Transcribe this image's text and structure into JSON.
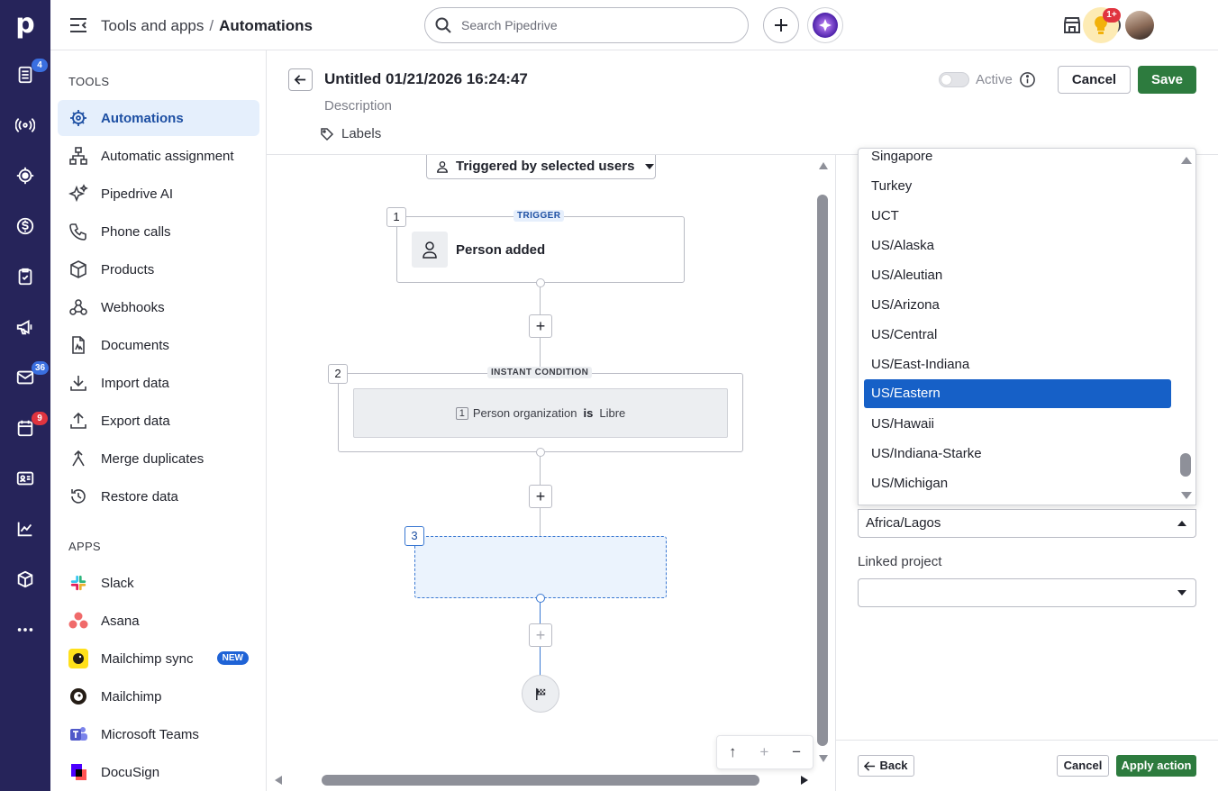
{
  "rail": {
    "logo": "p",
    "items": [
      {
        "icon": "deals-icon",
        "badge": "4"
      },
      {
        "icon": "broadcast-icon",
        "badge": ""
      },
      {
        "icon": "target-icon",
        "badge": ""
      },
      {
        "icon": "dollar-icon",
        "badge": ""
      },
      {
        "icon": "tasks-icon",
        "badge": ""
      },
      {
        "icon": "megaphone-icon",
        "badge": ""
      },
      {
        "icon": "mail-icon",
        "badge": "36"
      },
      {
        "icon": "calendar-icon",
        "badge": "9"
      },
      {
        "icon": "contacts-icon",
        "badge": ""
      },
      {
        "icon": "insights-icon",
        "badge": ""
      },
      {
        "icon": "products-icon",
        "badge": ""
      },
      {
        "icon": "more-icon",
        "badge": ""
      }
    ]
  },
  "topbar": {
    "breadcrumb_parent": "Tools and apps",
    "breadcrumb_sep": "/",
    "breadcrumb_current": "Automations",
    "search_placeholder": "Search Pipedrive",
    "notification_badge": "1+"
  },
  "sidebar": {
    "tools_heading": "TOOLS",
    "tools": [
      {
        "label": "Automations",
        "icon": "automations-icon",
        "active": true
      },
      {
        "label": "Automatic assignment",
        "icon": "assignment-icon"
      },
      {
        "label": "Pipedrive AI",
        "icon": "sparkle-icon"
      },
      {
        "label": "Phone calls",
        "icon": "phone-icon"
      },
      {
        "label": "Products",
        "icon": "box-icon"
      },
      {
        "label": "Webhooks",
        "icon": "webhook-icon"
      },
      {
        "label": "Documents",
        "icon": "document-icon"
      },
      {
        "label": "Import data",
        "icon": "import-icon"
      },
      {
        "label": "Export data",
        "icon": "export-icon"
      },
      {
        "label": "Merge duplicates",
        "icon": "merge-icon"
      },
      {
        "label": "Restore data",
        "icon": "restore-icon"
      }
    ],
    "apps_heading": "APPS",
    "apps": [
      {
        "label": "Slack",
        "icon": "slack-icon"
      },
      {
        "label": "Asana",
        "icon": "asana-icon"
      },
      {
        "label": "Mailchimp sync",
        "icon": "mailchimp-icon",
        "badge": "NEW"
      },
      {
        "label": "Mailchimp",
        "icon": "mailchimp-icon"
      },
      {
        "label": "Microsoft Teams",
        "icon": "teams-icon"
      },
      {
        "label": "DocuSign",
        "icon": "docusign-icon"
      }
    ]
  },
  "header": {
    "title": "Untitled 01/21/2026 16:24:47",
    "description": "Description",
    "labels": "Labels",
    "active_label": "Active",
    "cancel_label": "Cancel",
    "save_label": "Save"
  },
  "canvas": {
    "trigger_selector": "Triggered by selected users",
    "step1": {
      "number": "1",
      "tag": "TRIGGER",
      "title": "Person added"
    },
    "step2": {
      "number": "2",
      "tag": "INSTANT CONDITION",
      "cond_num": "1",
      "cond_field": "Person organization",
      "cond_op": "is",
      "cond_value": "Libre"
    },
    "step3": {
      "number": "3"
    },
    "zoom": {
      "up": "↑",
      "in": "+",
      "out": "−"
    }
  },
  "timezone_dropdown": {
    "options": [
      "Singapore",
      "Turkey",
      "UCT",
      "US/Alaska",
      "US/Aleutian",
      "US/Arizona",
      "US/Central",
      "US/East-Indiana",
      "US/Eastern",
      "US/Hawaii",
      "US/Indiana-Starke",
      "US/Michigan"
    ],
    "highlighted": "US/Eastern",
    "selected_value": "Africa/Lagos"
  },
  "linked_project": {
    "label": "Linked project",
    "value": ""
  },
  "footer": {
    "back_label": "Back",
    "cancel_label": "Cancel",
    "apply_label": "Apply action"
  },
  "colors": {
    "rail_bg": "#26245a",
    "save_green": "#2d7b3e",
    "highlight_blue": "#1660c7",
    "active_item_bg": "#e5effc"
  }
}
